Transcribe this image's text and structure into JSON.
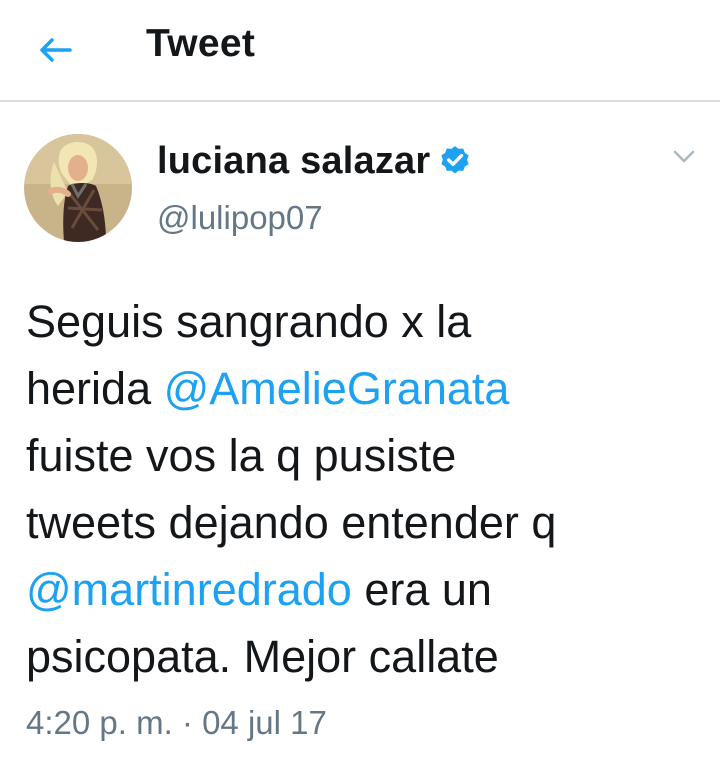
{
  "header": {
    "title": "Tweet",
    "back_icon": "arrow-left-icon",
    "accent": "#1da1f2"
  },
  "tweet": {
    "author_name": "luciana salazar",
    "verified": true,
    "handle": "@lulipop07",
    "menu_icon": "chevron-down-icon",
    "text_lines": [
      [
        {
          "text": "Seguis sangrando x la"
        }
      ],
      [
        {
          "text": "herida "
        },
        {
          "mention": "@AmelieGranata"
        }
      ],
      [
        {
          "text": "fuiste vos la q pusiste"
        }
      ],
      [
        {
          "text": "tweets dejando entender q"
        }
      ],
      [
        {
          "mention": "@martinredrado"
        },
        {
          "text": " era un"
        }
      ],
      [
        {
          "text": "psicopata. Mejor callate"
        }
      ]
    ],
    "time": "4:20 p. m.",
    "separator": " · ",
    "date": "04 jul 17"
  }
}
